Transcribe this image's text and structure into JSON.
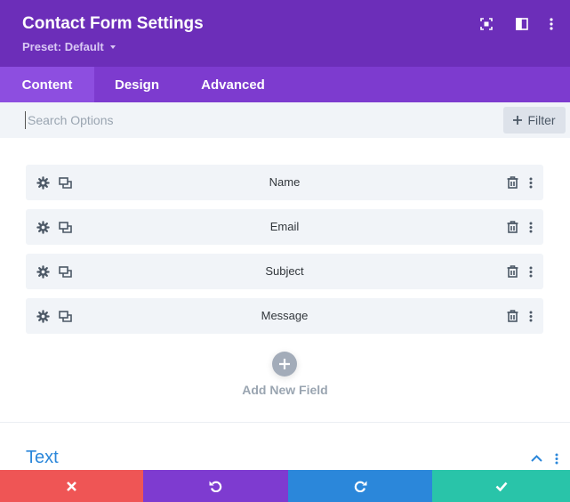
{
  "header": {
    "title": "Contact Form Settings",
    "preset_label": "Preset: Default",
    "icons": [
      "expand-icon",
      "sidebar-toggle-icon",
      "more-vertical-icon"
    ],
    "colors": {
      "background": "#6c2eb9",
      "text": "#ffffff"
    }
  },
  "tabs": [
    {
      "label": "Content",
      "active": true
    },
    {
      "label": "Design",
      "active": false
    },
    {
      "label": "Advanced",
      "active": false
    }
  ],
  "search": {
    "placeholder": "Search Options",
    "value": "",
    "filter_label": "Filter"
  },
  "fields": [
    {
      "label": "Name"
    },
    {
      "label": "Email"
    },
    {
      "label": "Subject"
    },
    {
      "label": "Message"
    }
  ],
  "row_icons": [
    "gear-icon",
    "duplicate-icon",
    "trash-icon",
    "more-vertical-icon"
  ],
  "add_field": {
    "label": "Add New Field"
  },
  "section": {
    "title": "Text",
    "expanded": true
  },
  "footer": {
    "buttons": [
      {
        "name": "cancel",
        "icon": "close-icon",
        "color": "#ef5555"
      },
      {
        "name": "undo",
        "icon": "undo-icon",
        "color": "#7e3bd0"
      },
      {
        "name": "redo",
        "icon": "redo-icon",
        "color": "#2b87da"
      },
      {
        "name": "save",
        "icon": "check-icon",
        "color": "#29c4a9"
      }
    ]
  }
}
